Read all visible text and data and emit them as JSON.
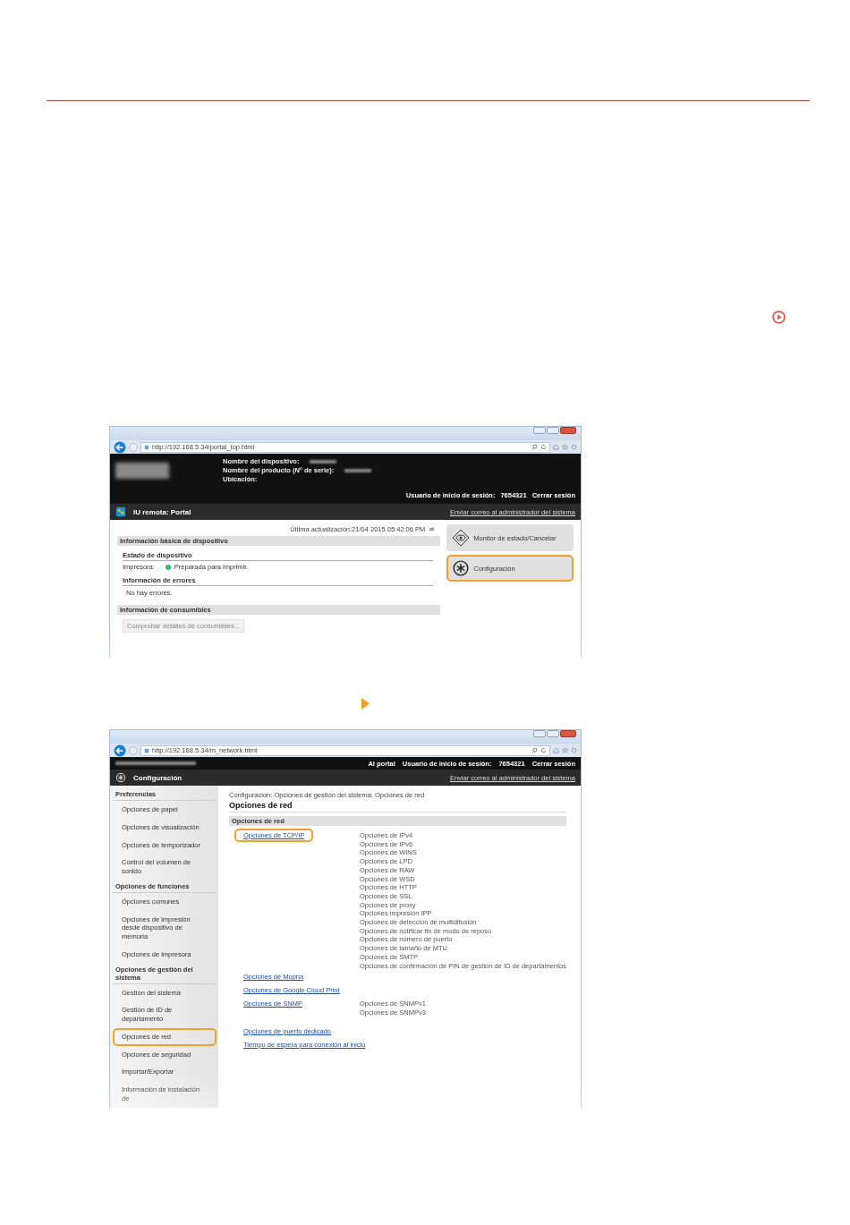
{
  "screens": [
    {
      "kind": "portal",
      "url": "http://192.168.5.34/portal_top.html",
      "device_labels": [
        "Nombre del dispositivo:",
        "Nombre del producto (N° de serie):",
        "Ubicación:"
      ],
      "login_label": "Usuario de inicio de sesión:",
      "user_id": "7654321",
      "logout": "Cerrar sesión",
      "title": "IU remota: Portal",
      "mail_link": "Enviar correo al administrador del sistema",
      "updated": "Última actualización:21/04 2015 05:42:06 PM",
      "sections": [
        {
          "title": "Información básica de dispositivo",
          "groups": [
            {
              "title": "Estado de dispositivo",
              "label": "Impresora:",
              "status": "Preparada para imprimir."
            },
            {
              "title": "Información de errores",
              "text": "No hay errores."
            }
          ]
        },
        {
          "title": "Información de consumibles",
          "button": "Comprobar detalles de consumibles..."
        }
      ],
      "side_buttons": [
        {
          "kind": "eye",
          "label": "Monitor de estado/Cancelar",
          "highlighted": false
        },
        {
          "kind": "gear",
          "label": "Configuración",
          "highlighted": true
        }
      ]
    },
    {
      "kind": "settings",
      "url": "http://192.168.5.34/m_network.html",
      "portal_link": "Al portal",
      "login_label": "Usuario de inicio de sesión:",
      "user_id": "7654321",
      "logout": "Cerrar sesión",
      "title": "Configuración",
      "mail_link": "Enviar correo al administrador del sistema",
      "sidebar": [
        {
          "heading": "Preferencias",
          "items": [
            {
              "label": "Opciones de papel",
              "highlighted": false
            },
            {
              "label": "Opciones de visualización",
              "highlighted": false
            },
            {
              "label": "Opciones de temporizador",
              "highlighted": false
            },
            {
              "label": "Control del volumen de sonido",
              "highlighted": false
            }
          ]
        },
        {
          "heading": "Opciones de funciones",
          "items": [
            {
              "label": "Opciones comunes",
              "highlighted": false
            },
            {
              "label": "Opciones de impresión desde dispositivo de memoria",
              "highlighted": false
            },
            {
              "label": "Opciones de impresora",
              "highlighted": false
            }
          ]
        },
        {
          "heading": "Opciones de gestión del sistema",
          "items": [
            {
              "label": "Gestión del sistema",
              "highlighted": false
            },
            {
              "label": "Gestión de ID de departamento",
              "highlighted": false
            },
            {
              "label": "Opciones de red",
              "highlighted": true
            },
            {
              "label": "Opciones de seguridad",
              "highlighted": false
            },
            {
              "label": "Importar/Exportar",
              "highlighted": false
            },
            {
              "label": "Información de instalación de",
              "highlighted": false
            }
          ]
        }
      ],
      "breadcrumb": "Configuración: Opciones de gestión del sistema: Opciones de red",
      "heading": "Opciones de red",
      "section_title": "Opciones de red",
      "links": [
        {
          "label": "Opciones de TCP/IP",
          "highlighted": true,
          "subitems": [
            "Opciones de IPv4",
            "Opciones de IPv6",
            "Opciones de WINS",
            "Opciones de LPD",
            "Opciones de RAW",
            "Opciones de WSD",
            "Opciones de HTTP",
            "Opciones de SSL",
            "Opciones de proxy",
            "Opciones impresión IPP",
            "Opciones de detección de multidifusión",
            "Opciones de notificar fin de modo de reposo",
            "Opciones de número de puerto",
            "Opciones de tamaño de MTU",
            "Opciones de SMTP",
            "Opciones de confirmación de PIN de gestión de ID de departamentos"
          ]
        },
        {
          "label": "Opciones de Mopria",
          "highlighted": false
        },
        {
          "label": "Opciones de Google Cloud Print",
          "highlighted": false
        },
        {
          "label": "Opciones de SNMP",
          "highlighted": false,
          "subitems": [
            "Opciones de SNMPv1",
            "Opciones de SNMPv3"
          ]
        },
        {
          "label": "Opciones de puerto dedicado",
          "highlighted": false
        },
        {
          "label": "Tiempo de espera para conexión al inicio",
          "highlighted": false
        }
      ]
    }
  ]
}
